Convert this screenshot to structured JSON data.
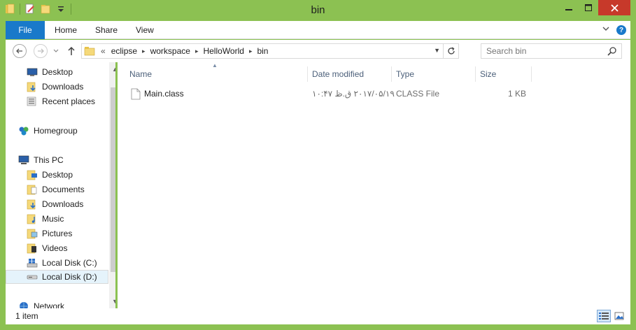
{
  "window": {
    "title": "bin"
  },
  "ribbon": {
    "tabs": [
      {
        "label": "File"
      },
      {
        "label": "Home"
      },
      {
        "label": "Share"
      },
      {
        "label": "View"
      }
    ]
  },
  "address": {
    "overflow": "«",
    "crumbs": [
      "eclipse",
      "workspace",
      "HelloWorld",
      "bin"
    ]
  },
  "search": {
    "placeholder": "Search bin"
  },
  "nav": {
    "items": [
      {
        "label": "Desktop",
        "icon": "desktop-icon"
      },
      {
        "label": "Downloads",
        "icon": "downloads-folder-icon"
      },
      {
        "label": "Recent places",
        "icon": "recent-places-icon"
      },
      {
        "label": "Homegroup",
        "icon": "homegroup-icon"
      },
      {
        "label": "This PC",
        "icon": "computer-icon"
      },
      {
        "label": "Desktop",
        "icon": "desktop-folder-icon"
      },
      {
        "label": "Documents",
        "icon": "documents-folder-icon"
      },
      {
        "label": "Downloads",
        "icon": "downloads-folder-icon"
      },
      {
        "label": "Music",
        "icon": "music-folder-icon"
      },
      {
        "label": "Pictures",
        "icon": "pictures-folder-icon"
      },
      {
        "label": "Videos",
        "icon": "videos-folder-icon"
      },
      {
        "label": "Local Disk (C:)",
        "icon": "system-drive-icon"
      },
      {
        "label": "Local Disk (D:)",
        "icon": "drive-icon"
      },
      {
        "label": "Network",
        "icon": "network-icon"
      }
    ]
  },
  "columns": {
    "name": "Name",
    "date": "Date modified",
    "type": "Type",
    "size": "Size"
  },
  "files": [
    {
      "name": "Main.class",
      "date": "۲۰۱۷/۰۵/۱۹ ق.ظ ۱۰:۴۷",
      "type": "CLASS File",
      "size": "1 KB"
    }
  ],
  "status": {
    "count": "1 item"
  },
  "colors": {
    "frame": "#8cc152",
    "file_tab": "#1979ca",
    "close": "#c7392a",
    "selection": "#e5f3fb"
  }
}
